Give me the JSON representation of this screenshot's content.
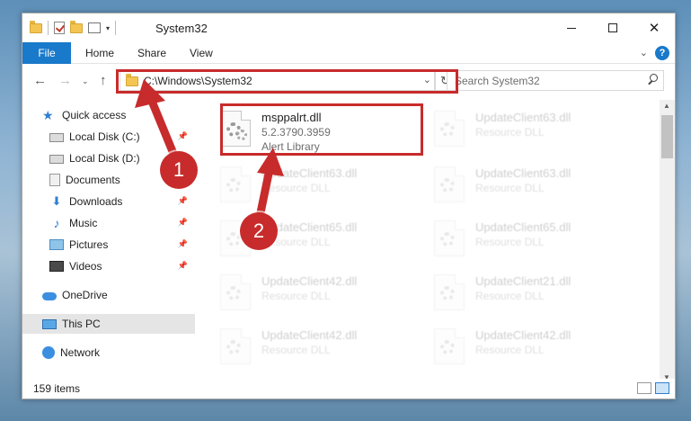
{
  "window": {
    "title": "System32",
    "controls": {
      "minimize": "",
      "maximize": "",
      "close": "✕"
    }
  },
  "quick_access_toolbar": {
    "separator": "|",
    "dropdown": "▾"
  },
  "ribbon": {
    "tabs": [
      "File",
      "Home",
      "Share",
      "View"
    ],
    "expand_icon": "⌄",
    "help_icon": "?"
  },
  "navigation": {
    "back": "←",
    "forward": "→",
    "recent": "⌄",
    "up": "↑",
    "address": "C:\\Windows\\System32",
    "address_dropdown": "⌄",
    "refresh": "↻",
    "search_placeholder": "Search System32"
  },
  "sidebar": {
    "items": [
      {
        "label": "Quick access",
        "icon": "star-icon",
        "glyph": "★",
        "pinned": false
      },
      {
        "label": "Local Disk (C:)",
        "icon": "drive-icon",
        "glyph": "",
        "pinned": true
      },
      {
        "label": "Local Disk (D:)",
        "icon": "drive-icon",
        "glyph": "",
        "pinned": true
      },
      {
        "label": "Documents",
        "icon": "documents-icon",
        "glyph": "",
        "pinned": true
      },
      {
        "label": "Downloads",
        "icon": "downloads-icon",
        "glyph": "⬇",
        "pinned": true
      },
      {
        "label": "Music",
        "icon": "music-icon",
        "glyph": "♪",
        "pinned": true
      },
      {
        "label": "Pictures",
        "icon": "pictures-icon",
        "glyph": "",
        "pinned": true
      },
      {
        "label": "Videos",
        "icon": "videos-icon",
        "glyph": "",
        "pinned": true
      },
      {
        "label": "OneDrive",
        "icon": "onedrive-icon",
        "glyph": "",
        "pinned": false
      },
      {
        "label": "This PC",
        "icon": "this-pc-icon",
        "glyph": "",
        "pinned": false,
        "selected": true
      },
      {
        "label": "Network",
        "icon": "network-icon",
        "glyph": "",
        "pinned": false
      }
    ],
    "pin_glyph": "📌"
  },
  "files": {
    "highlighted": {
      "name": "msppalrt.dll",
      "version": "5.2.3790.3959",
      "description": "Alert Library"
    },
    "background": [
      {
        "name": "UpdateClient63.dll",
        "description": "Resource DLL"
      },
      {
        "name": "UpdateClient63.dll",
        "description": "Resource DLL"
      },
      {
        "name": "UpdateClient63.dll",
        "description": "Resource DLL"
      },
      {
        "name": "UpdateClient65.dll",
        "description": "Resource DLL"
      },
      {
        "name": "UpdateClient65.dll",
        "description": "Resource DLL"
      },
      {
        "name": "UpdateClient42.dll",
        "description": "Resource DLL"
      },
      {
        "name": "UpdateClient21.dll",
        "description": "Resource DLL"
      },
      {
        "name": "UpdateClient42.dll",
        "description": "Resource DLL"
      },
      {
        "name": "UpdateClient42.dll",
        "description": "Resource DLL"
      }
    ]
  },
  "scrollbar": {
    "up": "▲",
    "down": "▼"
  },
  "status": {
    "item_count": "159 items"
  },
  "callouts": {
    "one": "1",
    "two": "2"
  },
  "colors": {
    "accent": "#1979ca",
    "annotation": "#c82b2b"
  }
}
